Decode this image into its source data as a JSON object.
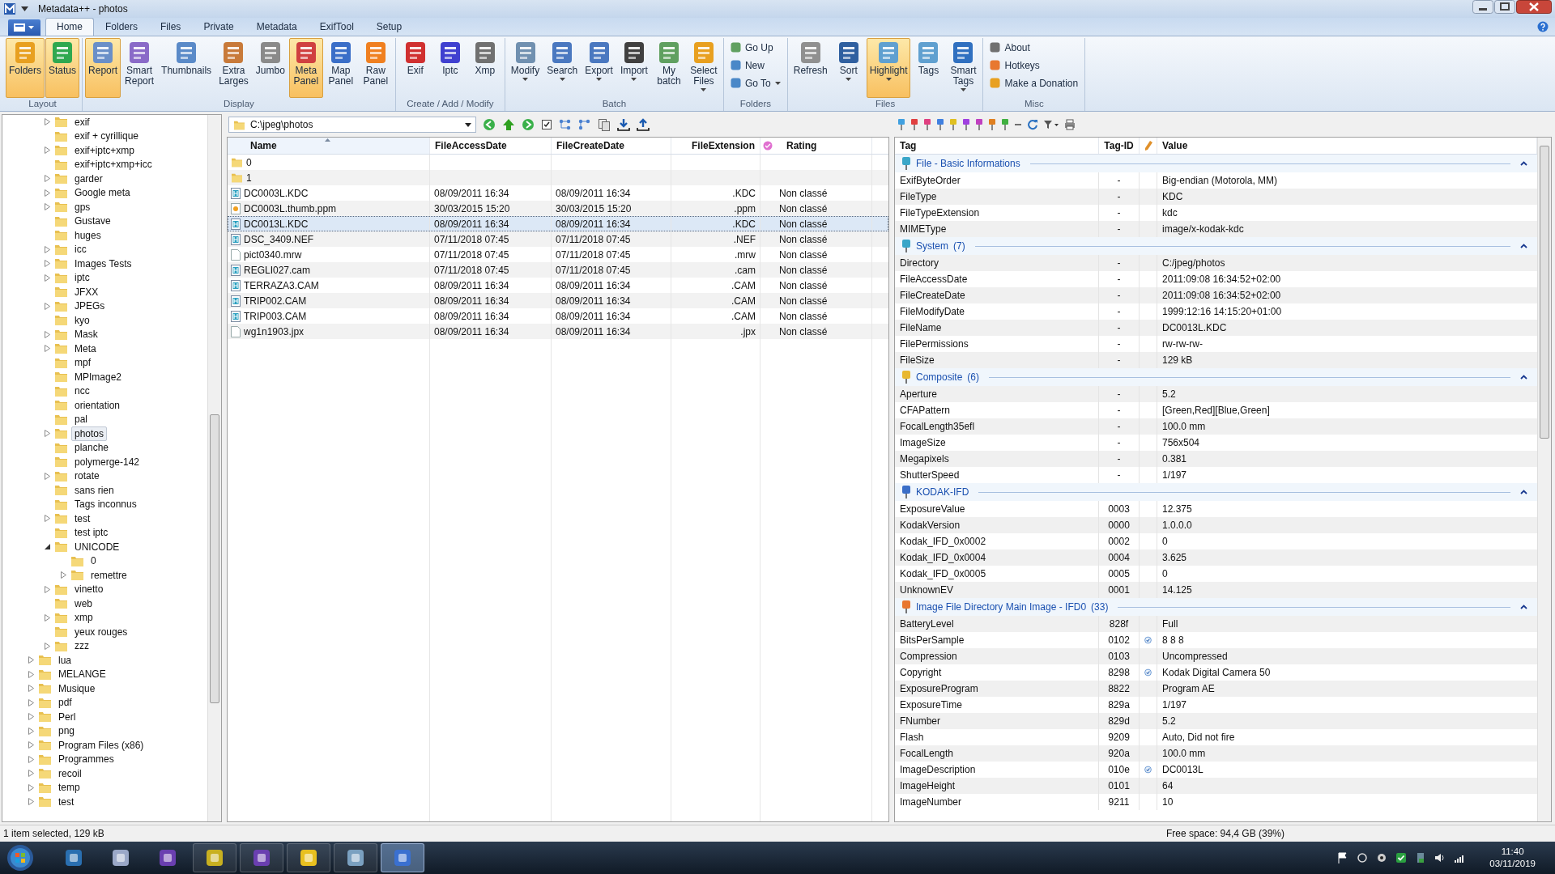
{
  "window": {
    "title": "Metadata++ - photos"
  },
  "tabs": [
    {
      "label": "Home",
      "selected": true
    },
    {
      "label": "Folders",
      "selected": false
    },
    {
      "label": "Files",
      "selected": false
    },
    {
      "label": "Private",
      "selected": false
    },
    {
      "label": "Metadata",
      "selected": false
    },
    {
      "label": "ExifTool",
      "selected": false
    },
    {
      "label": "Setup",
      "selected": false
    }
  ],
  "ribbon": {
    "groups": [
      {
        "label": "Layout",
        "buttons": [
          {
            "kind": "large",
            "label": "Folders",
            "selected": true,
            "dropdown": false
          },
          {
            "kind": "large",
            "label": "Status",
            "selected": true,
            "dropdown": false
          }
        ]
      },
      {
        "label": "Display",
        "buttons": [
          {
            "kind": "large",
            "label": "Report",
            "selected": true,
            "dropdown": false
          },
          {
            "kind": "large",
            "label": "Smart Report",
            "selected": false,
            "dropdown": false
          },
          {
            "kind": "large",
            "label": "Thumbnails",
            "selected": false,
            "dropdown": false
          },
          {
            "kind": "large",
            "label": "Extra Larges",
            "selected": false,
            "dropdown": false
          },
          {
            "kind": "large",
            "label": "Jumbo",
            "selected": false,
            "dropdown": false
          },
          {
            "kind": "large",
            "label": "Meta Panel",
            "selected": true,
            "dropdown": false
          },
          {
            "kind": "large",
            "label": "Map Panel",
            "selected": false,
            "dropdown": false
          },
          {
            "kind": "large",
            "label": "Raw Panel",
            "selected": false,
            "dropdown": false
          }
        ]
      },
      {
        "label": "Create / Add / Modify",
        "buttons": [
          {
            "kind": "large",
            "label": "Exif",
            "selected": false,
            "dropdown": false
          },
          {
            "kind": "large",
            "label": "Iptc",
            "selected": false,
            "dropdown": false
          },
          {
            "kind": "large",
            "label": "Xmp",
            "selected": false,
            "dropdown": false
          }
        ]
      },
      {
        "label": "Batch",
        "buttons": [
          {
            "kind": "large",
            "label": "Modify",
            "selected": false,
            "dropdown": true
          },
          {
            "kind": "large",
            "label": "Search",
            "selected": false,
            "dropdown": true
          },
          {
            "kind": "large",
            "label": "Export",
            "selected": false,
            "dropdown": true
          },
          {
            "kind": "large",
            "label": "Import",
            "selected": false,
            "dropdown": true
          },
          {
            "kind": "large",
            "label": "My batch",
            "selected": false,
            "dropdown": false
          },
          {
            "kind": "large",
            "label": "Select Files",
            "selected": false,
            "dropdown": true
          }
        ]
      },
      {
        "label": "Folders",
        "buttons": [
          {
            "kind": "small",
            "label": "Go Up",
            "selected": false,
            "dropdown": false
          },
          {
            "kind": "small",
            "label": "New",
            "selected": false,
            "dropdown": false
          },
          {
            "kind": "small",
            "label": "Go To",
            "selected": false,
            "dropdown": true
          }
        ]
      },
      {
        "label": "Files",
        "buttons": [
          {
            "kind": "large",
            "label": "Refresh",
            "selected": false,
            "dropdown": false
          },
          {
            "kind": "large",
            "label": "Sort",
            "selected": false,
            "dropdown": true
          },
          {
            "kind": "large",
            "label": "Highlight",
            "selected": true,
            "dropdown": true
          },
          {
            "kind": "large",
            "label": "Tags",
            "selected": false,
            "dropdown": false
          },
          {
            "kind": "large",
            "label": "Smart Tags",
            "selected": false,
            "dropdown": true
          }
        ]
      },
      {
        "label": "Misc",
        "buttons": [
          {
            "kind": "small",
            "label": "About",
            "selected": false,
            "dropdown": false
          },
          {
            "kind": "small",
            "label": "Hotkeys",
            "selected": false,
            "dropdown": false
          },
          {
            "kind": "small",
            "label": "Make a Donation",
            "selected": false,
            "dropdown": false
          }
        ]
      }
    ]
  },
  "tree": [
    {
      "children": [
        {
          "label": "exif",
          "expandable": true,
          "expanded": false,
          "selected": false
        },
        {
          "label": "exif + cyrillique",
          "expandable": false,
          "expanded": false,
          "selected": false
        },
        {
          "label": "exif+iptc+xmp",
          "expandable": true,
          "expanded": false,
          "selected": false
        },
        {
          "label": "exif+iptc+xmp+icc",
          "expandable": false,
          "expanded": false,
          "selected": false
        },
        {
          "label": "garder",
          "expandable": true,
          "expanded": false,
          "selected": false
        },
        {
          "label": "Google meta",
          "expandable": true,
          "expanded": false,
          "selected": false
        },
        {
          "label": "gps",
          "expandable": true,
          "expanded": false,
          "selected": false
        },
        {
          "label": "Gustave",
          "expandable": false,
          "expanded": false,
          "selected": false
        },
        {
          "label": "huges",
          "expandable": false,
          "expanded": false,
          "selected": false
        },
        {
          "label": "icc",
          "expandable": true,
          "expanded": false,
          "selected": false
        },
        {
          "label": "Images Tests",
          "expandable": true,
          "expanded": false,
          "selected": false
        },
        {
          "label": "iptc",
          "expandable": true,
          "expanded": false,
          "selected": false
        },
        {
          "label": "JFXX",
          "expandable": false,
          "expanded": false,
          "selected": false
        },
        {
          "label": "JPEGs",
          "expandable": true,
          "expanded": false,
          "selected": false
        },
        {
          "label": "kyo",
          "expandable": false,
          "expanded": false,
          "selected": false
        },
        {
          "label": "Mask",
          "expandable": true,
          "expanded": false,
          "selected": false
        },
        {
          "label": "Meta",
          "expandable": true,
          "expanded": false,
          "selected": false
        },
        {
          "label": "mpf",
          "expandable": false,
          "expanded": false,
          "selected": false
        },
        {
          "label": "MPImage2",
          "expandable": false,
          "expanded": false,
          "selected": false
        },
        {
          "label": "ncc",
          "expandable": false,
          "expanded": false,
          "selected": false
        },
        {
          "label": "orientation",
          "expandable": false,
          "expanded": false,
          "selected": false
        },
        {
          "label": "pal",
          "expandable": false,
          "expanded": false,
          "selected": false
        },
        {
          "label": "photos",
          "expandable": true,
          "expanded": false,
          "selected": true
        },
        {
          "label": "planche",
          "expandable": false,
          "expanded": false,
          "selected": false
        },
        {
          "label": "polymerge-142",
          "expandable": false,
          "expanded": false,
          "selected": false
        },
        {
          "label": "rotate",
          "expandable": true,
          "expanded": false,
          "selected": false
        },
        {
          "label": "sans rien",
          "expandable": false,
          "expanded": false,
          "selected": false
        },
        {
          "label": "Tags inconnus",
          "expandable": false,
          "expanded": false,
          "selected": false
        },
        {
          "label": "test",
          "expandable": true,
          "expanded": false,
          "selected": false
        },
        {
          "label": "test iptc",
          "expandable": false,
          "expanded": false,
          "selected": false
        },
        {
          "label": "UNICODE",
          "expandable": true,
          "expanded": true,
          "selected": false,
          "children": [
            {
              "label": "0",
              "expandable": false,
              "expanded": false,
              "selected": false
            },
            {
              "label": "remettre",
              "expandable": true,
              "expanded": false,
              "selected": false
            }
          ]
        },
        {
          "label": "vinetto",
          "expandable": true,
          "expanded": false,
          "selected": false
        },
        {
          "label": "web",
          "expandable": false,
          "expanded": false,
          "selected": false
        },
        {
          "label": "xmp",
          "expandable": true,
          "expanded": false,
          "selected": false
        },
        {
          "label": "yeux rouges",
          "expandable": false,
          "expanded": false,
          "selected": false
        },
        {
          "label": "zzz",
          "expandable": true,
          "expanded": false,
          "selected": false
        }
      ]
    },
    {
      "label": "lua",
      "expandable": true,
      "expanded": false,
      "selected": false
    },
    {
      "label": "MELANGE",
      "expandable": true,
      "expanded": false,
      "selected": false
    },
    {
      "label": "Musique",
      "expandable": true,
      "expanded": false,
      "selected": false
    },
    {
      "label": "pdf",
      "expandable": true,
      "expanded": false,
      "selected": false
    },
    {
      "label": "Perl",
      "expandable": true,
      "expanded": false,
      "selected": false
    },
    {
      "label": "png",
      "expandable": true,
      "expanded": false,
      "selected": false
    },
    {
      "label": "Program Files (x86)",
      "expandable": true,
      "expanded": false,
      "selected": false
    },
    {
      "label": "Programmes",
      "expandable": true,
      "expanded": false,
      "selected": false
    },
    {
      "label": "recoil",
      "expandable": true,
      "expanded": false,
      "selected": false
    },
    {
      "label": "temp",
      "expandable": true,
      "expanded": false,
      "selected": false
    },
    {
      "label": "test",
      "expandable": true,
      "expanded": false,
      "selected": false
    }
  ],
  "path_field": {
    "value": "C:\\jpeg\\photos"
  },
  "files": {
    "columns": [
      "Name",
      "FileAccessDate",
      "FileCreateDate",
      "FileExtension",
      "Rating"
    ],
    "rows": [
      {
        "kind": "folder",
        "selected": false,
        "cells": [
          "0",
          "",
          "",
          "",
          ""
        ]
      },
      {
        "kind": "folder",
        "selected": false,
        "cells": [
          "1",
          "",
          "",
          "",
          ""
        ]
      },
      {
        "kind": "raw",
        "selected": false,
        "cells": [
          "DC0003L.KDC",
          "08/09/2011 16:34",
          "08/09/2011 16:34",
          ".KDC",
          "Non classé"
        ]
      },
      {
        "kind": "image",
        "selected": false,
        "cells": [
          "DC0003L.thumb.ppm",
          "30/03/2015 15:20",
          "30/03/2015 15:20",
          ".ppm",
          "Non classé"
        ]
      },
      {
        "kind": "raw",
        "selected": true,
        "cells": [
          "DC0013L.KDC",
          "08/09/2011 16:34",
          "08/09/2011 16:34",
          ".KDC",
          "Non classé"
        ]
      },
      {
        "kind": "raw",
        "selected": false,
        "cells": [
          "DSC_3409.NEF",
          "07/11/2018 07:45",
          "07/11/2018 07:45",
          ".NEF",
          "Non classé"
        ]
      },
      {
        "kind": "blank",
        "selected": false,
        "cells": [
          "pict0340.mrw",
          "07/11/2018 07:45",
          "07/11/2018 07:45",
          ".mrw",
          "Non classé"
        ]
      },
      {
        "kind": "raw",
        "selected": false,
        "cells": [
          "REGLI027.cam",
          "07/11/2018 07:45",
          "07/11/2018 07:45",
          ".cam",
          "Non classé"
        ]
      },
      {
        "kind": "raw",
        "selected": false,
        "cells": [
          "TERRAZA3.CAM",
          "08/09/2011 16:34",
          "08/09/2011 16:34",
          ".CAM",
          "Non classé"
        ]
      },
      {
        "kind": "raw",
        "selected": false,
        "cells": [
          "TRIP002.CAM",
          "08/09/2011 16:34",
          "08/09/2011 16:34",
          ".CAM",
          "Non classé"
        ]
      },
      {
        "kind": "raw",
        "selected": false,
        "cells": [
          "TRIP003.CAM",
          "08/09/2011 16:34",
          "08/09/2011 16:34",
          ".CAM",
          "Non classé"
        ]
      },
      {
        "kind": "blank",
        "selected": false,
        "cells": [
          "wg1n1903.jpx",
          "08/09/2011 16:34",
          "08/09/2011 16:34",
          ".jpx",
          "Non classé"
        ]
      }
    ]
  },
  "properties": {
    "columns": [
      "Tag",
      "Tag-ID",
      "Value"
    ],
    "groups": [
      {
        "title": "File - Basic Informations",
        "color": "#3aa6c8",
        "rows": [
          {
            "tag": "ExifByteOrder",
            "id": "-",
            "checked": false,
            "value": "Big-endian (Motorola, MM)"
          },
          {
            "tag": "FileType",
            "id": "-",
            "checked": false,
            "value": "KDC"
          },
          {
            "tag": "FileTypeExtension",
            "id": "-",
            "checked": false,
            "value": "kdc"
          },
          {
            "tag": "MIMEType",
            "id": "-",
            "checked": false,
            "value": "image/x-kodak-kdc"
          }
        ]
      },
      {
        "title": "System",
        "count": "(7)",
        "color": "#3aa6c8",
        "rows": [
          {
            "tag": "Directory",
            "id": "-",
            "checked": false,
            "value": "C:/jpeg/photos"
          },
          {
            "tag": "FileAccessDate",
            "id": "-",
            "checked": false,
            "value": "2011:09:08 16:34:52+02:00"
          },
          {
            "tag": "FileCreateDate",
            "id": "-",
            "checked": false,
            "value": "2011:09:08 16:34:52+02:00"
          },
          {
            "tag": "FileModifyDate",
            "id": "-",
            "checked": false,
            "value": "1999:12:16 14:15:20+01:00"
          },
          {
            "tag": "FileName",
            "id": "-",
            "checked": false,
            "value": "DC0013L.KDC"
          },
          {
            "tag": "FilePermissions",
            "id": "-",
            "checked": false,
            "value": "rw-rw-rw-"
          },
          {
            "tag": "FileSize",
            "id": "-",
            "checked": false,
            "value": "129 kB"
          }
        ]
      },
      {
        "title": "Composite",
        "count": "(6)",
        "color": "#e8b830",
        "rows": [
          {
            "tag": "Aperture",
            "id": "-",
            "checked": false,
            "value": "5.2"
          },
          {
            "tag": "CFAPattern",
            "id": "-",
            "checked": false,
            "value": "[Green,Red][Blue,Green]"
          },
          {
            "tag": "FocalLength35efl",
            "id": "-",
            "checked": false,
            "value": "100.0 mm"
          },
          {
            "tag": "ImageSize",
            "id": "-",
            "checked": false,
            "value": "756x504"
          },
          {
            "tag": "Megapixels",
            "id": "-",
            "checked": false,
            "value": "0.381"
          },
          {
            "tag": "ShutterSpeed",
            "id": "-",
            "checked": false,
            "value": "1/197"
          }
        ]
      },
      {
        "title": "KODAK-IFD",
        "color": "#3a6ec8",
        "rows": [
          {
            "tag": "ExposureValue",
            "id": "0003",
            "checked": false,
            "value": "12.375"
          },
          {
            "tag": "KodakVersion",
            "id": "0000",
            "checked": false,
            "value": "1.0.0.0"
          },
          {
            "tag": "Kodak_IFD_0x0002",
            "id": "0002",
            "checked": false,
            "value": "0"
          },
          {
            "tag": "Kodak_IFD_0x0004",
            "id": "0004",
            "checked": false,
            "value": "3.625"
          },
          {
            "tag": "Kodak_IFD_0x0005",
            "id": "0005",
            "checked": false,
            "value": "0"
          },
          {
            "tag": "UnknownEV",
            "id": "0001",
            "checked": false,
            "value": "14.125"
          }
        ]
      },
      {
        "title": "Image File Directory Main Image - IFD0",
        "count": "(33)",
        "color": "#e87830",
        "rows": [
          {
            "tag": "BatteryLevel",
            "id": "828f",
            "checked": false,
            "value": "Full"
          },
          {
            "tag": "BitsPerSample",
            "id": "0102",
            "checked": true,
            "value": "8 8 8"
          },
          {
            "tag": "Compression",
            "id": "0103",
            "checked": false,
            "value": "Uncompressed"
          },
          {
            "tag": "Copyright",
            "id": "8298",
            "checked": true,
            "value": "Kodak Digital Camera 50"
          },
          {
            "tag": "ExposureProgram",
            "id": "8822",
            "checked": false,
            "value": "Program AE"
          },
          {
            "tag": "ExposureTime",
            "id": "829a",
            "checked": false,
            "value": "1/197"
          },
          {
            "tag": "FNumber",
            "id": "829d",
            "checked": false,
            "value": "5.2"
          },
          {
            "tag": "Flash",
            "id": "9209",
            "checked": false,
            "value": "Auto, Did not fire"
          },
          {
            "tag": "FocalLength",
            "id": "920a",
            "checked": false,
            "value": "100.0 mm"
          },
          {
            "tag": "ImageDescription",
            "id": "010e",
            "checked": true,
            "value": "DC0013L"
          },
          {
            "tag": "ImageHeight",
            "id": "0101",
            "checked": false,
            "value": "64"
          },
          {
            "tag": "ImageNumber",
            "id": "9211",
            "checked": false,
            "value": "10"
          }
        ]
      }
    ]
  },
  "status_bar": {
    "left": "1 item selected, 129 kB",
    "right": "Free space: 94,4 GB  (39%)"
  },
  "taskbar": {
    "apps": [
      {
        "selected": false
      },
      {
        "selected": false
      },
      {
        "selected": false
      },
      {
        "selected": false
      },
      {
        "selected": false
      },
      {
        "selected": false
      },
      {
        "selected": false
      },
      {
        "selected": true
      }
    ],
    "time": "11:40",
    "date": "03/11/2019"
  }
}
